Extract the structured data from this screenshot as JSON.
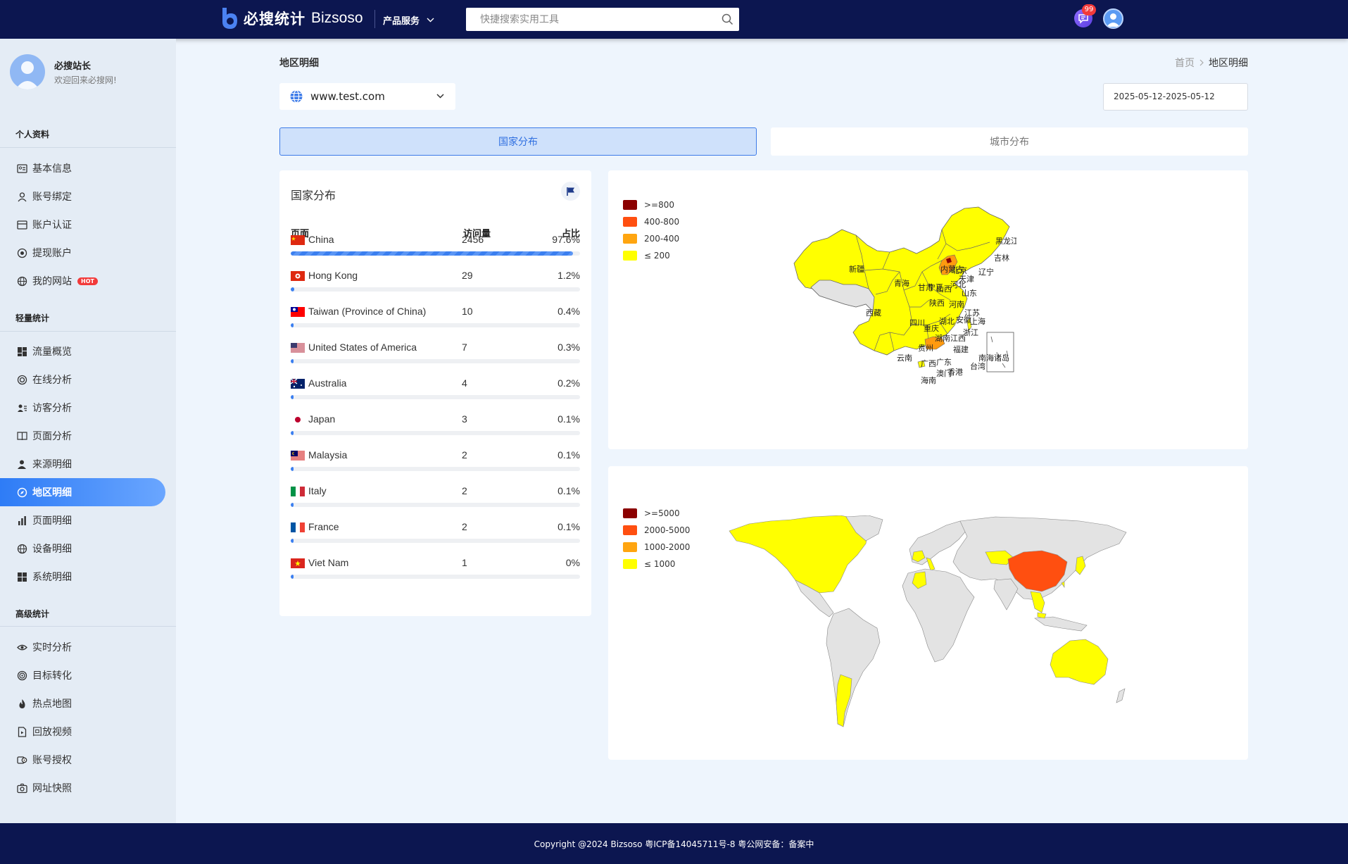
{
  "header": {
    "brand_cn": "必搜统计",
    "brand_en": "Bizsoso",
    "product_menu": "产品服务",
    "search_placeholder": "快捷搜索实用工具",
    "message_badge": "99"
  },
  "sidebar": {
    "profile_name": "必搜站长",
    "profile_sub": "欢迎回来必搜网!",
    "sections": [
      {
        "title": "个人资料",
        "items": [
          {
            "label": "基本信息",
            "icon": "id-card-icon"
          },
          {
            "label": "账号绑定",
            "icon": "user-icon"
          },
          {
            "label": "账户认证",
            "icon": "card-icon"
          },
          {
            "label": "提现账户",
            "icon": "wallet-icon"
          },
          {
            "label": "我的网站",
            "icon": "globe-icon",
            "badge": "HOT"
          }
        ]
      },
      {
        "title": "轻量统计",
        "items": [
          {
            "label": "流量概览",
            "icon": "dashboard-icon"
          },
          {
            "label": "在线分析",
            "icon": "lifebuoy-icon"
          },
          {
            "label": "访客分析",
            "icon": "users-icon"
          },
          {
            "label": "页面分析",
            "icon": "book-icon"
          },
          {
            "label": "来源明细",
            "icon": "person-icon"
          },
          {
            "label": "地区明细",
            "icon": "compass-icon",
            "active": true
          },
          {
            "label": "页面明细",
            "icon": "bar-chart-icon"
          },
          {
            "label": "设备明细",
            "icon": "globe-icon"
          },
          {
            "label": "系统明细",
            "icon": "grid-icon"
          }
        ]
      },
      {
        "title": "高级统计",
        "items": [
          {
            "label": "实时分析",
            "icon": "eye-icon"
          },
          {
            "label": "目标转化",
            "icon": "target-icon"
          },
          {
            "label": "热点地图",
            "icon": "flame-icon"
          },
          {
            "label": "回放视频",
            "icon": "file-play-icon"
          },
          {
            "label": "账号授权",
            "icon": "key-icon"
          },
          {
            "label": "网址快照",
            "icon": "camera-icon"
          }
        ]
      }
    ]
  },
  "main": {
    "page_title": "地区明细",
    "breadcrumb": [
      "首页",
      "地区明细"
    ],
    "site_select": "www.test.com",
    "date_range": "2025-05-12-2025-05-12",
    "tabs": [
      {
        "label": "国家分布",
        "active": true
      },
      {
        "label": "城市分布",
        "active": false
      }
    ],
    "country_card": {
      "title": "国家分布",
      "columns": [
        "页面",
        "访问量",
        "占比"
      ],
      "rows": [
        {
          "name": "China",
          "visits": "2456",
          "pct": "97.6%",
          "fill": 0.976,
          "flag": "cn"
        },
        {
          "name": "Hong Kong",
          "visits": "29",
          "pct": "1.2%",
          "fill": 0.012,
          "flag": "hk"
        },
        {
          "name": "Taiwan (Province of China)",
          "visits": "10",
          "pct": "0.4%",
          "fill": 0.004,
          "flag": "tw"
        },
        {
          "name": "United States of America",
          "visits": "7",
          "pct": "0.3%",
          "fill": 0.003,
          "flag": "us"
        },
        {
          "name": "Australia",
          "visits": "4",
          "pct": "0.2%",
          "fill": 0.002,
          "flag": "au"
        },
        {
          "name": "Japan",
          "visits": "3",
          "pct": "0.1%",
          "fill": 0.001,
          "flag": "jp"
        },
        {
          "name": "Malaysia",
          "visits": "2",
          "pct": "0.1%",
          "fill": 0.001,
          "flag": "my"
        },
        {
          "name": "Italy",
          "visits": "2",
          "pct": "0.1%",
          "fill": 0.001,
          "flag": "it"
        },
        {
          "name": "France",
          "visits": "2",
          "pct": "0.1%",
          "fill": 0.001,
          "flag": "fr"
        },
        {
          "name": "Viet Nam",
          "visits": "1",
          "pct": "0%",
          "fill": 0.0,
          "flag": "vn"
        }
      ]
    },
    "china_map": {
      "legend": [
        {
          "label": ">=800",
          "color": "#8b0000"
        },
        {
          "label": "400-800",
          "color": "#ff4f10"
        },
        {
          "label": "200-400",
          "color": "#ffa510"
        },
        {
          "label": "≤ 200",
          "color": "#ffff00"
        }
      ],
      "provinces": [
        "新疆",
        "西藏",
        "青海",
        "甘肃",
        "内蒙古",
        "黑龙江",
        "吉林",
        "辽宁",
        "北京",
        "天津",
        "河北",
        "山西",
        "宁夏",
        "陕西",
        "山东",
        "河南",
        "江苏",
        "安徽",
        "上海",
        "浙江",
        "湖北",
        "四川",
        "重庆",
        "湖南",
        "江西",
        "福建",
        "贵州",
        "云南",
        "广西",
        "广东",
        "澳门",
        "香港",
        "台湾",
        "海南",
        "南海诸岛"
      ]
    },
    "world_map": {
      "legend": [
        {
          "label": ">=5000",
          "color": "#8b0000"
        },
        {
          "label": "2000-5000",
          "color": "#ff4f10"
        },
        {
          "label": "1000-2000",
          "color": "#ffa510"
        },
        {
          "label": "≤ 1000",
          "color": "#ffff00"
        }
      ]
    }
  },
  "footer": {
    "text": "Copyright @2024 Bizsoso 粤ICP备14045711号-8 粤公网安备：备案中"
  }
}
